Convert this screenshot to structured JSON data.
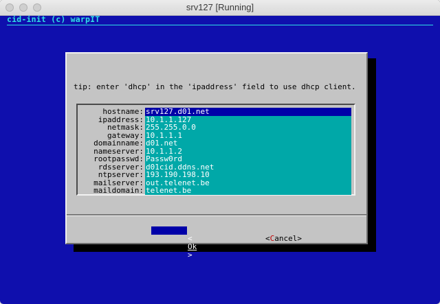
{
  "window": {
    "title": "srv127 [Running]"
  },
  "banner": "cid-init (c) warpIT",
  "dialog": {
    "tip": "tip: enter 'dhcp' in the 'ipaddress' field to use dhcp client.",
    "fields": [
      {
        "label": "hostname:",
        "value": "srv127.d01.net",
        "selected": true
      },
      {
        "label": "ipaddress:",
        "value": "10.1.1.127"
      },
      {
        "label": "netmask:",
        "value": "255.255.0.0"
      },
      {
        "label": "gateway:",
        "value": "10.1.1.1"
      },
      {
        "label": "domainname:",
        "value": "d01.net"
      },
      {
        "label": "nameserver:",
        "value": "10.1.1.2"
      },
      {
        "label": "rootpasswd:",
        "value": "Passw0rd"
      },
      {
        "label": "rdsserver:",
        "value": "d01cid.ddns.net"
      },
      {
        "label": "ntpserver:",
        "value": "193.190.198.10"
      },
      {
        "label": "mailserver:",
        "value": "out.telenet.be"
      },
      {
        "label": "maildomain:",
        "value": "telenet.be"
      }
    ],
    "buttons": {
      "ok_left": "<",
      "ok_label": "Ok",
      "ok_right": ">",
      "cancel_open": "<",
      "cancel_hot": "C",
      "cancel_rest": "ancel",
      "cancel_close": ">"
    }
  },
  "colors": {
    "screen_bg": "#0f0fad",
    "banner_fg": "#2fe0e6",
    "dialog_bg": "#c4c4c4",
    "field_bg": "#00a8a8",
    "selected_bg": "#0000a8",
    "hotkey_fg": "#c00000"
  }
}
